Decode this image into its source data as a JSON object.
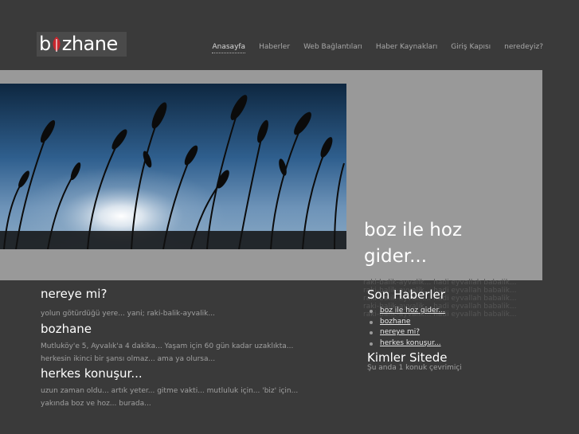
{
  "brand": {
    "name_start": "b",
    "name_end": "zhane"
  },
  "nav": {
    "items": [
      {
        "label": "Anasayfa"
      },
      {
        "label": "Haberler"
      },
      {
        "label": "Web Bağlantıları"
      },
      {
        "label": "Haber Kaynakları"
      },
      {
        "label": "Giriş Kapısı"
      },
      {
        "label": "neredeyiz?"
      }
    ]
  },
  "hero": {
    "title": "boz ile hoz gider...",
    "lines": [
      "raki-balik-ayvalik... hadi eyvallah babalik...",
      "raki-balik-ayvalik... hadi eyvallah babalik...",
      "raki-balik-ayvalik... hadi eyvallah babalik...",
      "raki-balik-ayvalik... hadi eyvallah babalik...",
      "raki-balik-ayvalik... hadi eyvallah babalik..."
    ]
  },
  "posts": [
    {
      "title": "nereye mi?",
      "body": "yolun götürdüğü yere... yani; raki-balik-ayvalik..."
    },
    {
      "title": "bozhane",
      "body": "Mutluköy'e 5, Ayvalık'a 4 dakika... Yaşam için 60 gün kadar uzaklıkta... herkesin ikinci bir şansı olmaz... ama ya olursa..."
    },
    {
      "title": "herkes konuşur...",
      "body": "uzun zaman oldu... artık yeter... gitme vakti... mutluluk için... 'biz' için... yakında boz ve hoz... burada..."
    }
  ],
  "sidebar": {
    "news_title": "Son Haberler",
    "news": [
      {
        "label": "boz ile hoz gider..."
      },
      {
        "label": "bozhane"
      },
      {
        "label": "nereye mi?"
      },
      {
        "label": "herkes konuşur..."
      }
    ],
    "online_title": "Kimler Sitede",
    "online_text": "Şu anda 1 konuk çevrimiçi"
  },
  "colors": {
    "background": "#3a3a3a",
    "hero_panel": "#999999",
    "leaf": "#c8262d"
  }
}
